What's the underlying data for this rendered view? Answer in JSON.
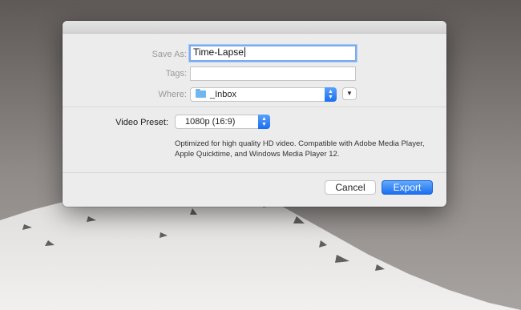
{
  "dialog": {
    "save_as_label": "Save As:",
    "save_as_value": "Time-Lapse",
    "tags_label": "Tags:",
    "tags_value": "",
    "where_label": "Where:",
    "where_value": "_Inbox",
    "video_preset_label": "Video Preset:",
    "video_preset_value": "1080p (16:9)",
    "description_line1": "Optimized for high quality HD video. Compatible with Adobe Media Player,",
    "description_line2": "Apple Quicktime, and Windows Media Player 12.",
    "cancel_label": "Cancel",
    "export_label": "Export"
  },
  "colors": {
    "accent": "#1c70ef",
    "focus_ring": "#7aaaf0",
    "folder": "#6fb7ee",
    "dialog_bg": "#ececec"
  },
  "icons": {
    "folder": "folder-icon",
    "popup_arrows": "up-down-arrows-icon",
    "expand": "chevron-down-icon"
  }
}
